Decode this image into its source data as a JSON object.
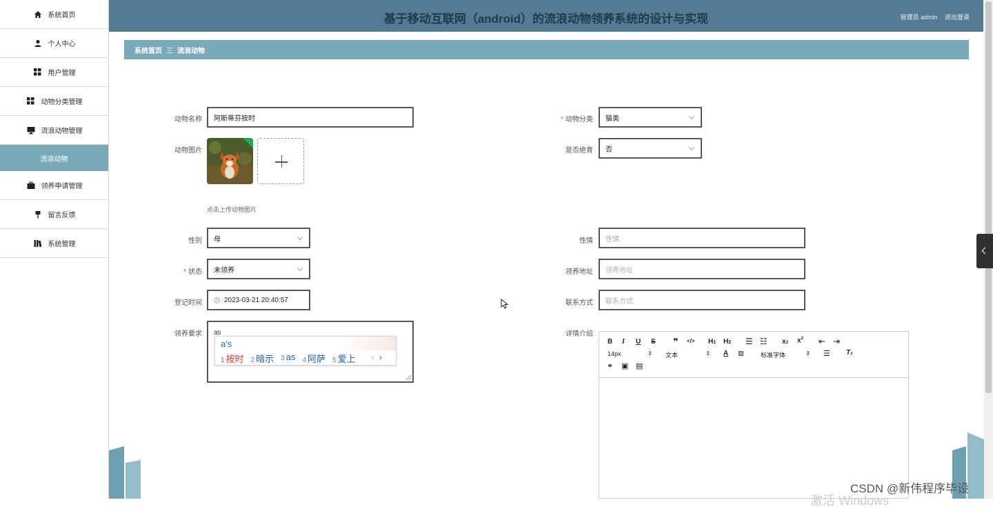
{
  "sidebar": {
    "items": [
      {
        "label": "系统首页",
        "icon": "home-icon"
      },
      {
        "label": "个人中心",
        "icon": "user-icon"
      },
      {
        "label": "用户管理",
        "icon": "grid-icon"
      },
      {
        "label": "动物分类管理",
        "icon": "grid-icon"
      },
      {
        "label": "流浪动物管理",
        "icon": "monitor-icon"
      }
    ],
    "active_sub": "流浪动物",
    "items_after": [
      {
        "label": "领养申请管理",
        "icon": "briefcase-icon"
      },
      {
        "label": "留言反馈",
        "icon": "pin-icon"
      },
      {
        "label": "系统管理",
        "icon": "library-icon"
      }
    ]
  },
  "header": {
    "title": "基于移动互联网（android）的流浪动物领养系统的设计与实现",
    "user": "管理员 admin",
    "logout": "退出登录",
    "color": "#547b93"
  },
  "breadcrumb": {
    "home": "系统首页",
    "separator": "三",
    "current": "流浪动物"
  },
  "form": {
    "name_label": "动物名称",
    "name_value": "阿斯蒂芬按时",
    "category_label": "动物分类",
    "category_value": "猫类",
    "photo_label": "动物图片",
    "photo_hint": "点击上传动物图片",
    "sterilized_label": "是否绝育",
    "sterilized_value": "否",
    "gender_label": "性别",
    "gender_value": "母",
    "temper_label": "性情",
    "temper_placeholder": "性情",
    "status_label": "状态",
    "status_value": "未领养",
    "address_label": "领养地址",
    "address_placeholder": "领养地址",
    "date_label": "登记时间",
    "date_value": "2023-03-21 20:40:57",
    "contact_label": "联系方式",
    "contact_placeholder": "联系方式",
    "requirement_label": "领养要求",
    "requirement_typed": "as",
    "detail_label": "详情介绍"
  },
  "ime": {
    "composition": "a's",
    "candidates": [
      {
        "n": "1",
        "text": "按时"
      },
      {
        "n": "2",
        "text": "暗示"
      },
      {
        "n": "3",
        "text": "as"
      },
      {
        "n": "4",
        "text": "阿萨"
      },
      {
        "n": "5",
        "text": "爱上"
      }
    ],
    "prev": "‹",
    "next": "›"
  },
  "editor": {
    "font_size": "14px",
    "text_type": "文本",
    "font_family": "标准字体"
  },
  "watermark": "CSDN @新伟程序毕设",
  "windows_text": "激活 Windows"
}
